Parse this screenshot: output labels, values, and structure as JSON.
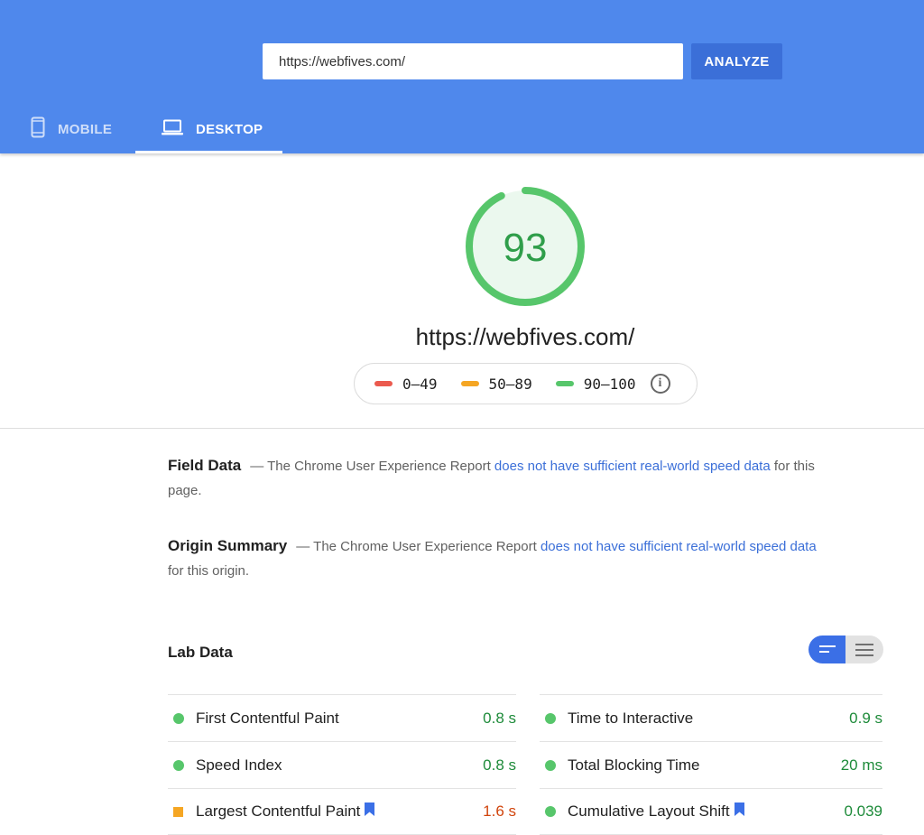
{
  "header": {
    "url_value": "https://webfives.com/",
    "analyze_label": "ANALYZE",
    "tabs": [
      {
        "label": "MOBILE",
        "icon": "phone-icon",
        "active": false
      },
      {
        "label": "DESKTOP",
        "icon": "laptop-icon",
        "active": true
      }
    ],
    "color": "#4f88ec"
  },
  "score": {
    "value": "93",
    "value_num": 93,
    "url": "https://webfives.com/",
    "color": "#57c66b"
  },
  "legend": {
    "items": [
      {
        "range": "0–49",
        "color": "#eb5a4e"
      },
      {
        "range": "50–89",
        "color": "#f5a623"
      },
      {
        "range": "90–100",
        "color": "#57c66b"
      }
    ],
    "info_icon": "info-icon"
  },
  "field_data": {
    "title": "Field Data",
    "prefix": "— The Chrome User Experience Report ",
    "link": "does not have sufficient real-world speed data",
    "suffix": " for this page."
  },
  "origin_summary": {
    "title": "Origin Summary",
    "prefix": "— The Chrome User Experience Report ",
    "link": "does not have sufficient real-world speed data",
    "suffix": " for this origin."
  },
  "lab_data": {
    "title": "Lab Data",
    "toggle": {
      "active": "compact-view-icon",
      "inactive": "expanded-view-icon"
    },
    "metrics_left": [
      {
        "name": "First Contentful Paint",
        "value": "0.8 s",
        "status": "pass",
        "bookmark": false
      },
      {
        "name": "Speed Index",
        "value": "0.8 s",
        "status": "pass",
        "bookmark": false
      },
      {
        "name": "Largest Contentful Paint",
        "value": "1.6 s",
        "status": "average",
        "bookmark": true
      }
    ],
    "metrics_right": [
      {
        "name": "Time to Interactive",
        "value": "0.9 s",
        "status": "pass",
        "bookmark": false
      },
      {
        "name": "Total Blocking Time",
        "value": "20 ms",
        "status": "pass",
        "bookmark": false
      },
      {
        "name": "Cumulative Layout Shift",
        "value": "0.039",
        "status": "pass",
        "bookmark": true
      }
    ]
  }
}
